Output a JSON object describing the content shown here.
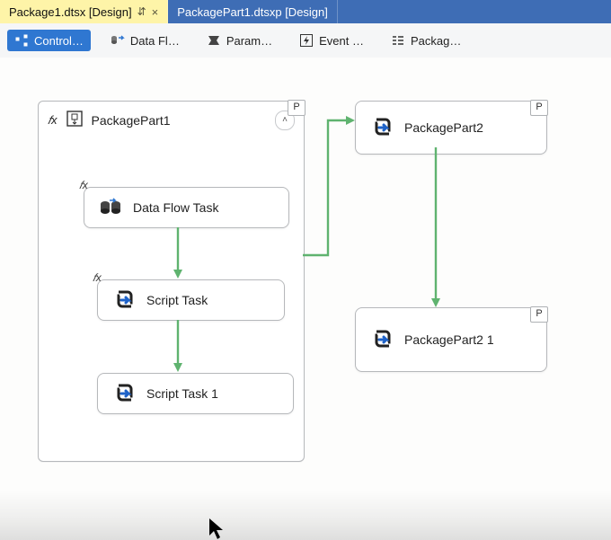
{
  "tabs": {
    "active_label": "Package1.dtsx [Design]",
    "inactive_label": "PackagePart1.dtsxp [Design]"
  },
  "toolbar": {
    "control": "Control…",
    "dataflow": "Data Fl…",
    "parameters": "Param…",
    "events": "Event …",
    "package": "Packag…"
  },
  "parts": {
    "part1": {
      "title": "PackagePart1",
      "badge": "P"
    },
    "part2": {
      "title": "PackagePart2",
      "badge": "P"
    },
    "part21": {
      "title": "PackagePart2 1",
      "badge": "P"
    }
  },
  "tasks": {
    "data_flow": "Data Flow Task",
    "script": "Script Task",
    "script1": "Script Task 1"
  },
  "glyphs": {
    "pin": "⇵",
    "close": "×",
    "collapse": "˄"
  },
  "colors": {
    "accent": "#2f77d1",
    "arrow": "#5fb36f",
    "tab_active": "#fef4a8",
    "tab_inactive": "#3e6db5"
  }
}
